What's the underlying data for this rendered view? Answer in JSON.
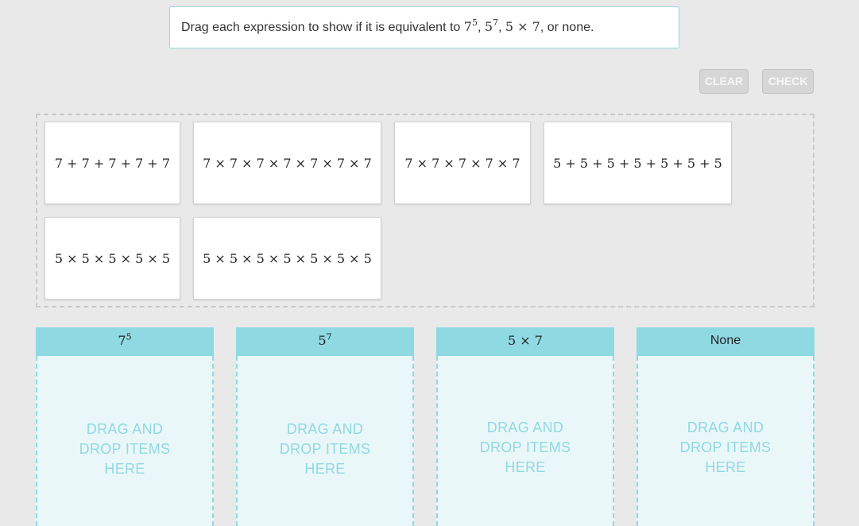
{
  "prompt": {
    "before": "Drag each expression to show if it is equivalent to ",
    "t1_base": "7",
    "t1_exp": "5",
    "sep1": ", ",
    "t2_base": "5",
    "t2_exp": "7",
    "sep2": ", ",
    "t3": "5 × 7",
    "after": ", or none."
  },
  "buttons": {
    "clear": "CLEAR",
    "check": "CHECK"
  },
  "cards": [
    "7 + 7 + 7 + 7 + 7",
    "7 × 7 × 7 × 7 × 7 × 7 × 7",
    "7 × 7 × 7 × 7 × 7",
    "5 + 5 + 5 + 5 + 5 + 5 + 5",
    "5 × 5 × 5 × 5 × 5",
    "5 × 5 × 5 × 5 × 5 × 5 × 5"
  ],
  "zones": [
    {
      "base": "7",
      "exp": "5",
      "hint": [
        "DRAG AND",
        "DROP ITEMS",
        "HERE"
      ]
    },
    {
      "base": "5",
      "exp": "7",
      "hint": [
        "DRAG AND",
        "DROP ITEMS",
        "HERE"
      ]
    },
    {
      "label": "5 × 7",
      "hint": [
        "DRAG AND",
        "DROP ITEMS",
        "HERE"
      ]
    },
    {
      "label": "None",
      "hint": [
        "DRAG AND",
        "DROP ITEMS",
        "HERE"
      ]
    }
  ],
  "colors": {
    "accent": "#8fd9e3",
    "zone_bg": "#eaf7f8",
    "page_bg": "#e9e9e9"
  }
}
